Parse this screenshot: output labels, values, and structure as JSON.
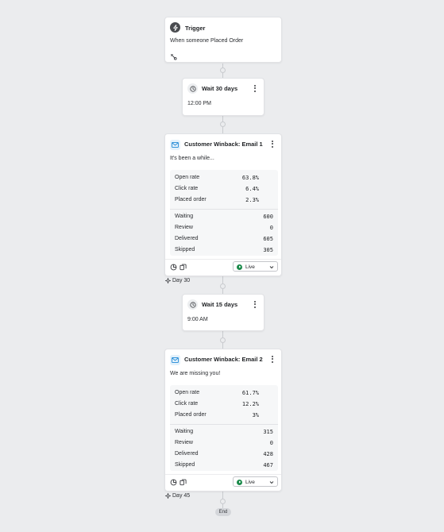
{
  "trigger": {
    "title": "Trigger",
    "description": "When someone Placed Order",
    "icon": "lightning-icon"
  },
  "wait1": {
    "title": "Wait 30 days",
    "time": "12:00 PM",
    "icon": "clock-icon"
  },
  "email1": {
    "title": "Customer Winback: Email 1",
    "subject": "It's been a while...",
    "icon": "envelope-icon",
    "rates": [
      {
        "label": "Open rate",
        "value": "63.8%"
      },
      {
        "label": "Click rate",
        "value": "6.4%"
      },
      {
        "label": "Placed order",
        "value": "2.3%"
      }
    ],
    "counts": [
      {
        "label": "Waiting",
        "value": "600"
      },
      {
        "label": "Review",
        "value": "0"
      },
      {
        "label": "Delivered",
        "value": "605"
      },
      {
        "label": "Skipped",
        "value": "305"
      }
    ],
    "status": "Live",
    "day_label": "Day 30"
  },
  "wait2": {
    "title": "Wait 15 days",
    "time": "9:00 AM",
    "icon": "clock-icon"
  },
  "email2": {
    "title": "Customer Winback: Email 2",
    "subject": "We are missing you!",
    "icon": "envelope-icon",
    "rates": [
      {
        "label": "Open rate",
        "value": "61.7%"
      },
      {
        "label": "Click rate",
        "value": "12.2%"
      },
      {
        "label": "Placed order",
        "value": "3%"
      }
    ],
    "counts": [
      {
        "label": "Waiting",
        "value": "315"
      },
      {
        "label": "Review",
        "value": "0"
      },
      {
        "label": "Delivered",
        "value": "428"
      },
      {
        "label": "Skipped",
        "value": "467"
      }
    ],
    "status": "Live",
    "day_label": "Day 45"
  },
  "end_label": "End",
  "colors": {
    "background": "#ebecee",
    "live_green": "#1a8a4a",
    "email_icon_blue": "#1e88d6",
    "email_icon_bg": "#e3f1fb"
  }
}
